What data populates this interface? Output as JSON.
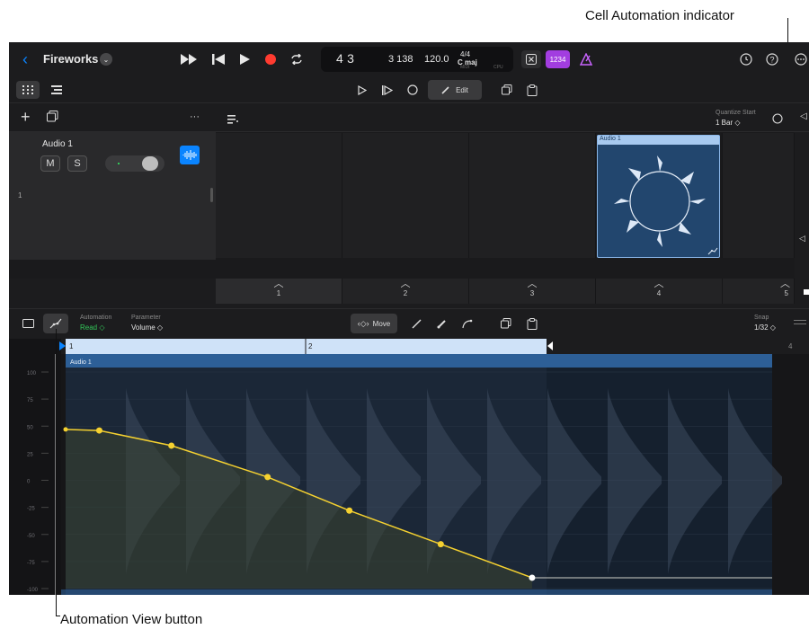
{
  "callouts": {
    "cell_automation_indicator": "Cell Automation indicator",
    "automation_view_button": "Automation View button"
  },
  "project": {
    "name": "Fireworks"
  },
  "lcd": {
    "position": "4 3",
    "sub": "3 138",
    "tempo": "120.0",
    "signature": "4/4",
    "key": "C maj",
    "midi_label": "MIDI",
    "cpu_label": "CPU"
  },
  "toolbar": {
    "count_in": "1234",
    "edit_label": "Edit"
  },
  "track_header": {
    "more": "···",
    "quantize_label": "Quantize Start",
    "quantize_value": "1 Bar ◇"
  },
  "track": {
    "name": "Audio 1",
    "number": "1",
    "mute": "M",
    "solo": "S"
  },
  "cell_clip": {
    "name": "Audio 1"
  },
  "scenes": [
    "1",
    "2",
    "3",
    "4",
    "5"
  ],
  "automation": {
    "mode_label": "Automation",
    "mode_value": "Read ◇",
    "param_label": "Parameter",
    "param_value": "Volume ◇",
    "move_label": "Move",
    "snap_label": "Snap",
    "snap_value": "1/32 ◇"
  },
  "ruler": {
    "markers": [
      "1",
      "2",
      "4"
    ]
  },
  "region": {
    "name": "Audio 1"
  },
  "y_axis": [
    "100",
    "75",
    "50",
    "25",
    "0",
    "-25",
    "-50",
    "-75",
    "-100"
  ],
  "automation_points": [
    {
      "t": 0.0,
      "v": 47
    },
    {
      "t": 0.07,
      "v": 46
    },
    {
      "t": 0.22,
      "v": 32
    },
    {
      "t": 0.42,
      "v": 3
    },
    {
      "t": 0.59,
      "v": -28
    },
    {
      "t": 0.78,
      "v": -59
    },
    {
      "t": 0.97,
      "v": -90
    }
  ],
  "colors": {
    "accent_blue": "#0a84ff",
    "record_red": "#ff3b30",
    "count_in_purple": "#a23de0",
    "read_green": "#33c759",
    "automation_yellow": "#f5d130",
    "region_blue": "#2d5f97"
  }
}
